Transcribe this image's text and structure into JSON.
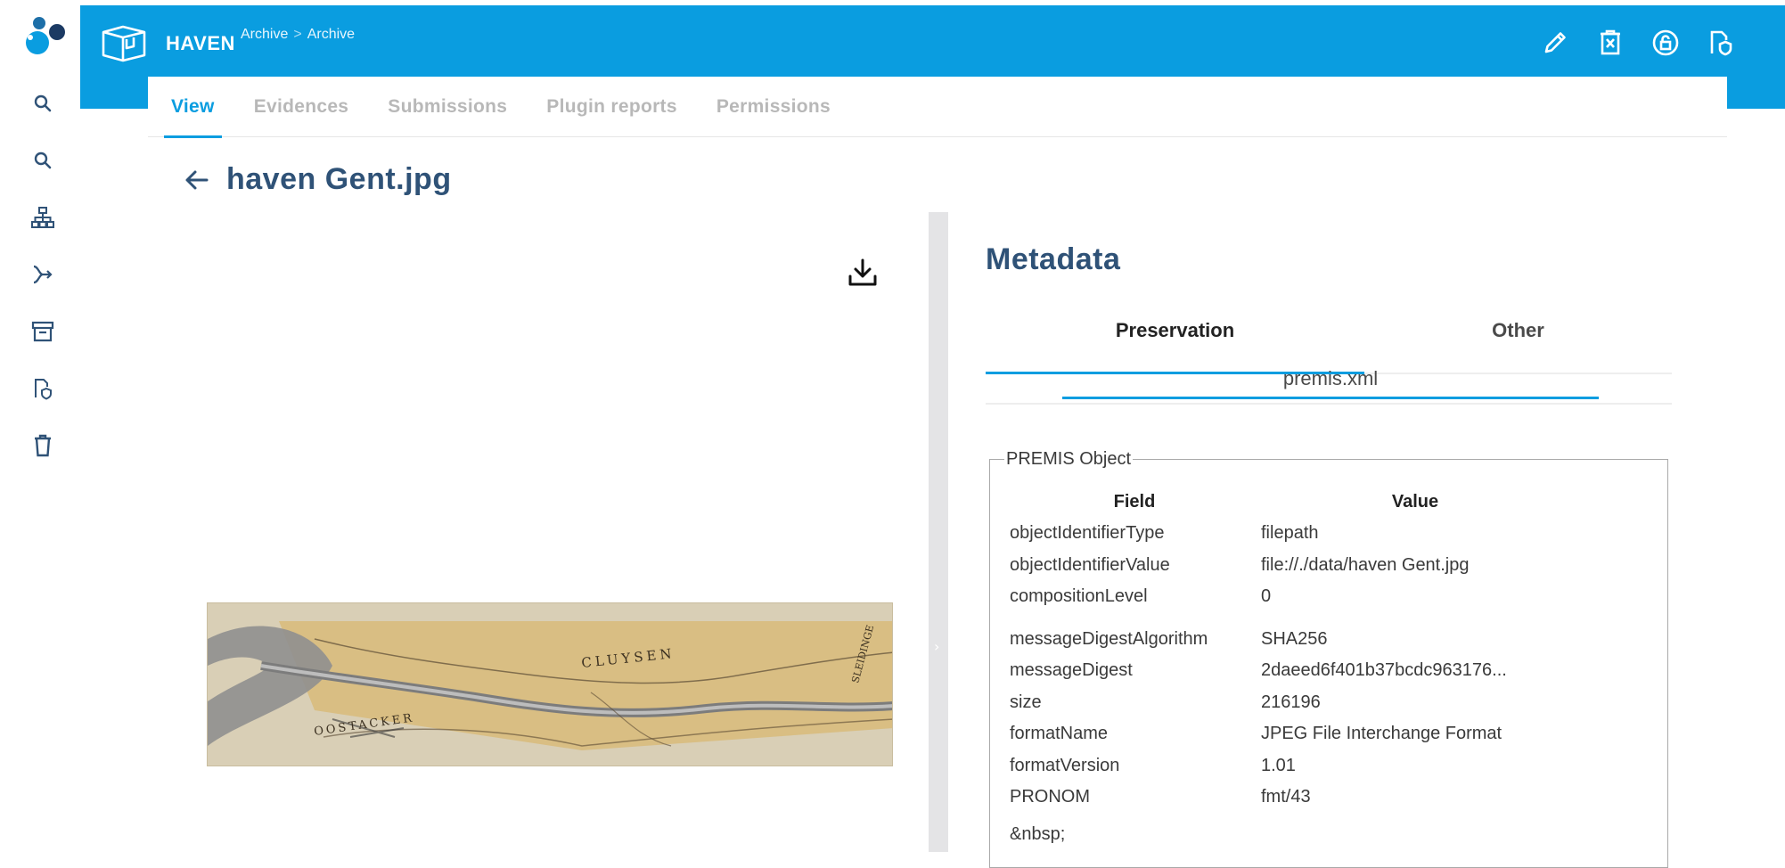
{
  "rail": {
    "items": [
      {
        "icon": "search-icon"
      },
      {
        "icon": "search-icon"
      },
      {
        "icon": "hierarchy-icon"
      },
      {
        "icon": "ingest-flow-icon"
      },
      {
        "icon": "archive-box-icon"
      },
      {
        "icon": "shield-document-icon"
      },
      {
        "icon": "trash-icon"
      }
    ]
  },
  "header": {
    "brand": "HAVEN",
    "breadcrumbs": [
      "Archive",
      ">",
      "Archive"
    ],
    "actions": [
      "edit-icon",
      "delete-document-icon",
      "lock-icon",
      "shield-document-icon"
    ]
  },
  "tabs": [
    {
      "label": "View",
      "active": true
    },
    {
      "label": "Evidences",
      "active": false
    },
    {
      "label": "Submissions",
      "active": false
    },
    {
      "label": "Plugin reports",
      "active": false
    },
    {
      "label": "Permissions",
      "active": false
    }
  ],
  "page": {
    "title": "haven Gent.jpg"
  },
  "metadata": {
    "heading": "Metadata",
    "tabs": [
      "Preservation",
      "Other"
    ],
    "subtab": "premis.xml",
    "legend": "PREMIS Object",
    "columns": [
      "Field",
      "Value"
    ],
    "rows": [
      {
        "field": "objectIdentifierType",
        "value": "filepath"
      },
      {
        "field": "objectIdentifierValue",
        "value": "file://./data/haven Gent.jpg"
      },
      {
        "field": "compositionLevel",
        "value": "0"
      },
      {
        "field": "messageDigestAlgorithm",
        "value": "SHA256"
      },
      {
        "field": "messageDigest",
        "value": "2daeed6f401b37bcdc963176..."
      },
      {
        "field": "size",
        "value": "216196"
      },
      {
        "field": "formatName",
        "value": "JPEG File Interchange Format"
      },
      {
        "field": "formatVersion",
        "value": "1.01"
      },
      {
        "field": "PRONOM",
        "value": "fmt/43"
      }
    ],
    "trailing": "&nbsp;"
  },
  "map_labels": [
    "CLUYSEN",
    "OOSTACKER",
    "SLEIDINGE"
  ],
  "colors": {
    "brand_blue": "#0a9de0",
    "title_navy": "#2f5277"
  }
}
